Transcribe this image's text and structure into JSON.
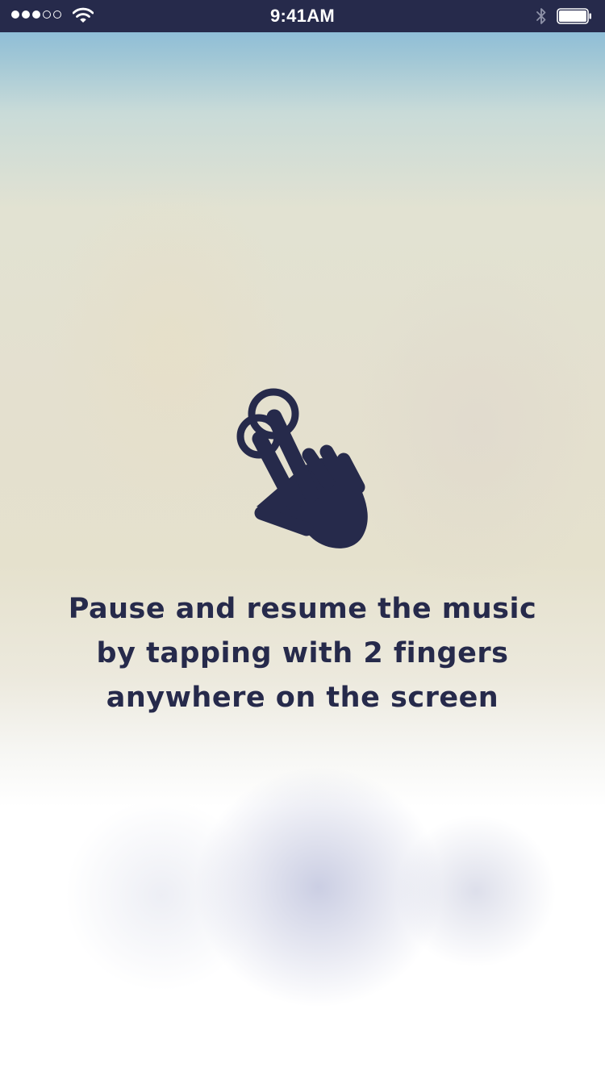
{
  "status_bar": {
    "signal": {
      "filled": 3,
      "total": 5
    },
    "wifi_icon": "wifi-icon",
    "time": "9:41AM",
    "bluetooth_icon": "bluetooth-icon",
    "battery_icon": "battery-icon",
    "battery_level": 1.0,
    "background_color": "#262a4b"
  },
  "tutorial": {
    "icon": "two-finger-tap-icon",
    "instruction_lines": [
      "Pause and resume the music",
      "by tapping with 2 fingers",
      "anywhere on the screen"
    ],
    "text_color": "#262a4b"
  }
}
